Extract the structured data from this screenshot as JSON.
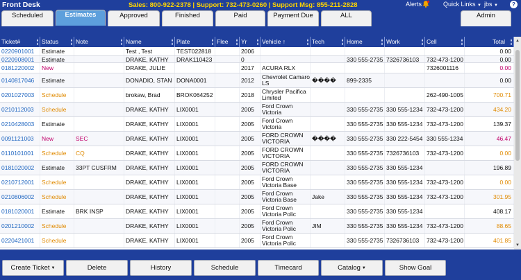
{
  "app": {
    "title": "Front Desk",
    "support_line": "Sales: 800-922-2378 | Support: 732-473-0260 | Support Msg: 855-211-2828",
    "alerts_label": "Alerts",
    "quick_links_label": "Quick Links",
    "user_label": "jbs",
    "help_label": "?"
  },
  "tabs": [
    {
      "label": "Scheduled",
      "active": false
    },
    {
      "label": "Estimates",
      "active": true
    },
    {
      "label": "Approved",
      "active": false
    },
    {
      "label": "Finished",
      "active": false
    },
    {
      "label": "Paid",
      "active": false
    },
    {
      "label": "Payment Due",
      "active": false
    },
    {
      "label": "ALL",
      "active": false
    },
    {
      "label": "Admin",
      "active": false
    }
  ],
  "columns": [
    "Ticket#",
    "Status",
    "Note",
    "Name",
    "Plate",
    "Flee",
    "Yr",
    "Vehicle",
    "Tech",
    "Home",
    "Work",
    "Cell",
    "Total"
  ],
  "sort_indicator": "↑",
  "rows": [
    {
      "ticket": "0220901001",
      "status": "Estimate",
      "note": "",
      "name": "Test , Test",
      "plate": "TEST022818",
      "flee": "",
      "yr": "2006",
      "vehicle": "",
      "tech": "",
      "home": "",
      "work": "",
      "cell": "",
      "total": "0.00"
    },
    {
      "ticket": "0220908001",
      "status": "Estimate",
      "note": "",
      "name": "DRAKE, KATHY",
      "plate": "DRAK110423",
      "flee": "",
      "yr": "0",
      "vehicle": "",
      "tech": "",
      "home": "330 555-2735",
      "work": "7326736103",
      "cell": "732-473-1200",
      "total": "0.00"
    },
    {
      "ticket": "0181220002",
      "status": "New",
      "note": "",
      "name": "DRAKE, JULIE",
      "plate": "",
      "flee": "",
      "yr": "2017",
      "vehicle": "ACURA RLX",
      "tech": "",
      "home": "",
      "work": "",
      "cell": "7326001116",
      "total": "0.00"
    },
    {
      "ticket": "0140817046",
      "status": "Estimate",
      "note": "",
      "name": "DONADIO, STAN",
      "plate": "DONA0001",
      "flee": "",
      "yr": "2012",
      "vehicle": "Chevrolet Camaro LS",
      "tech": "����",
      "home": "899-2335",
      "work": "",
      "cell": "",
      "total": "0.00"
    },
    {
      "ticket": "0201027003",
      "status": "Schedule",
      "note": "",
      "name": "brokaw, Brad",
      "plate": "BROK064252",
      "flee": "",
      "yr": "2018",
      "vehicle": "Chrysler Pacifica Limited",
      "tech": "",
      "home": "",
      "work": "",
      "cell": "262-490-1005",
      "total": "700.71"
    },
    {
      "ticket": "0210112003",
      "status": "Schedule",
      "note": "",
      "name": "DRAKE, KATHY",
      "plate": "LIX0001",
      "flee": "",
      "yr": "2005",
      "vehicle": "Ford Crown Victoria",
      "tech": "",
      "home": "330 555-2735",
      "work": "330 555-1234",
      "cell": "732-473-1200",
      "total": "434.20"
    },
    {
      "ticket": "0210428003",
      "status": "Estimate",
      "note": "",
      "name": "DRAKE, KATHY",
      "plate": "LIX0001",
      "flee": "",
      "yr": "2005",
      "vehicle": "Ford Crown Victoria",
      "tech": "",
      "home": "330 555-2735",
      "work": "330 555-1234",
      "cell": "732-473-1200",
      "total": "139.37"
    },
    {
      "ticket": "0091121003",
      "status": "New",
      "note": "SEC",
      "name": "DRAKE, KATHY",
      "plate": "LIX0001",
      "flee": "",
      "yr": "2005",
      "vehicle": "FORD CROWN VICTORIA",
      "tech": "����",
      "home": "330 555-2735",
      "work": "330 222-5454",
      "cell": "330 555-1234",
      "total": "46.47"
    },
    {
      "ticket": "0110101001",
      "status": "Schedule",
      "note": "CQ",
      "name": "DRAKE, KATHY",
      "plate": "LIX0001",
      "flee": "",
      "yr": "2005",
      "vehicle": "FORD CROWN VICTORIA",
      "tech": "",
      "home": "330 555-2735",
      "work": "7326736103",
      "cell": "732-473-1200",
      "total": "0.00"
    },
    {
      "ticket": "0181020002",
      "status": "Estimate",
      "note": "33PT CUSFRM",
      "name": "DRAKE, KATHY",
      "plate": "LIX0001",
      "flee": "",
      "yr": "2005",
      "vehicle": "FORD CROWN VICTORIA",
      "tech": "",
      "home": "330 555-2735",
      "work": "330 555-1234",
      "cell": "",
      "total": "196.89"
    },
    {
      "ticket": "0210712001",
      "status": "Schedule",
      "note": "",
      "name": "DRAKE, KATHY",
      "plate": "LIX0001",
      "flee": "",
      "yr": "2005",
      "vehicle": "Ford Crown Victoria Base",
      "tech": "",
      "home": "330 555-2735",
      "work": "330 555-1234",
      "cell": "732-473-1200",
      "total": "0.00"
    },
    {
      "ticket": "0210806002",
      "status": "Schedule",
      "note": "",
      "name": "DRAKE, KATHY",
      "plate": "LIX0001",
      "flee": "",
      "yr": "2005",
      "vehicle": "Ford Crown Victoria Base",
      "tech": "Jake",
      "home": "330 555-2735",
      "work": "330 555-1234",
      "cell": "732-473-1200",
      "total": "301.95"
    },
    {
      "ticket": "0181020001",
      "status": "Estimate",
      "note": "BRK INSP",
      "name": "DRAKE, KATHY",
      "plate": "LIX0001",
      "flee": "",
      "yr": "2005",
      "vehicle": "Ford Crown Victoria Polic",
      "tech": "",
      "home": "330 555-2735",
      "work": "330 555-1234",
      "cell": "",
      "total": "408.17"
    },
    {
      "ticket": "0201210002",
      "status": "Schedule",
      "note": "",
      "name": "DRAKE, KATHY",
      "plate": "LIX0001",
      "flee": "",
      "yr": "2005",
      "vehicle": "Ford Crown Victoria Polic",
      "tech": "JIM",
      "home": "330 555-2735",
      "work": "330 555-1234",
      "cell": "732-473-1200",
      "total": "88.65"
    },
    {
      "ticket": "0220421001",
      "status": "Schedule",
      "note": "",
      "name": "DRAKE, KATHY",
      "plate": "LIX0001",
      "flee": "",
      "yr": "2005",
      "vehicle": "Ford Crown Victoria Polic",
      "tech": "",
      "home": "330 555-2735",
      "work": "7326736103",
      "cell": "732-473-1200",
      "total": "401.85"
    }
  ],
  "footer": {
    "create_ticket": "Create Ticket",
    "delete": "Delete",
    "history": "History",
    "schedule": "Schedule",
    "timecard": "Timecard",
    "catalog": "Catalog",
    "show_goal": "Show Goal",
    "dropdown_caret": "▼"
  },
  "colors": {
    "brand_blue": "#1f3f9c",
    "active_tab": "#5d9fdc",
    "ticket_link": "#2167c1",
    "status_new": "#c0006a",
    "status_schedule": "#e08a00",
    "support_text": "#ffd500"
  }
}
